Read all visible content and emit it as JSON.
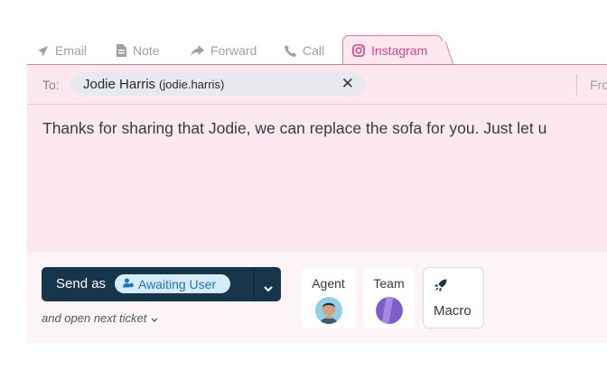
{
  "tabs": [
    {
      "label": "Email",
      "icon": "paper-plane-icon"
    },
    {
      "label": "Note",
      "icon": "note-icon"
    },
    {
      "label": "Forward",
      "icon": "forward-arrow-icon"
    },
    {
      "label": "Call",
      "icon": "phone-icon"
    },
    {
      "label": "Instagram",
      "icon": "instagram-icon",
      "active": true
    }
  ],
  "compose": {
    "to_label": "To:",
    "recipient": {
      "name": "Jodie Harris",
      "handle": "(jodie.harris)",
      "remove_glyph": "✕"
    },
    "from_label": "Fro",
    "message": "Thanks for sharing that Jodie, we can replace the sofa for you. Just let u"
  },
  "send": {
    "label": "Send as",
    "status": "Awaiting User",
    "status_icon": "user-clock-icon",
    "caret_icon": "chevron-down-icon",
    "next_ticket": "and open next ticket"
  },
  "assign": {
    "agent_label": "Agent",
    "team_label": "Team",
    "macro_label": "Macro",
    "macro_icon": "rocket-icon"
  },
  "colors": {
    "accent": "#d4437f",
    "panel_bg": "#fde8f0",
    "send_button": "#17364c",
    "status_text": "#1f73b7",
    "status_bg": "#d6ecfb"
  }
}
